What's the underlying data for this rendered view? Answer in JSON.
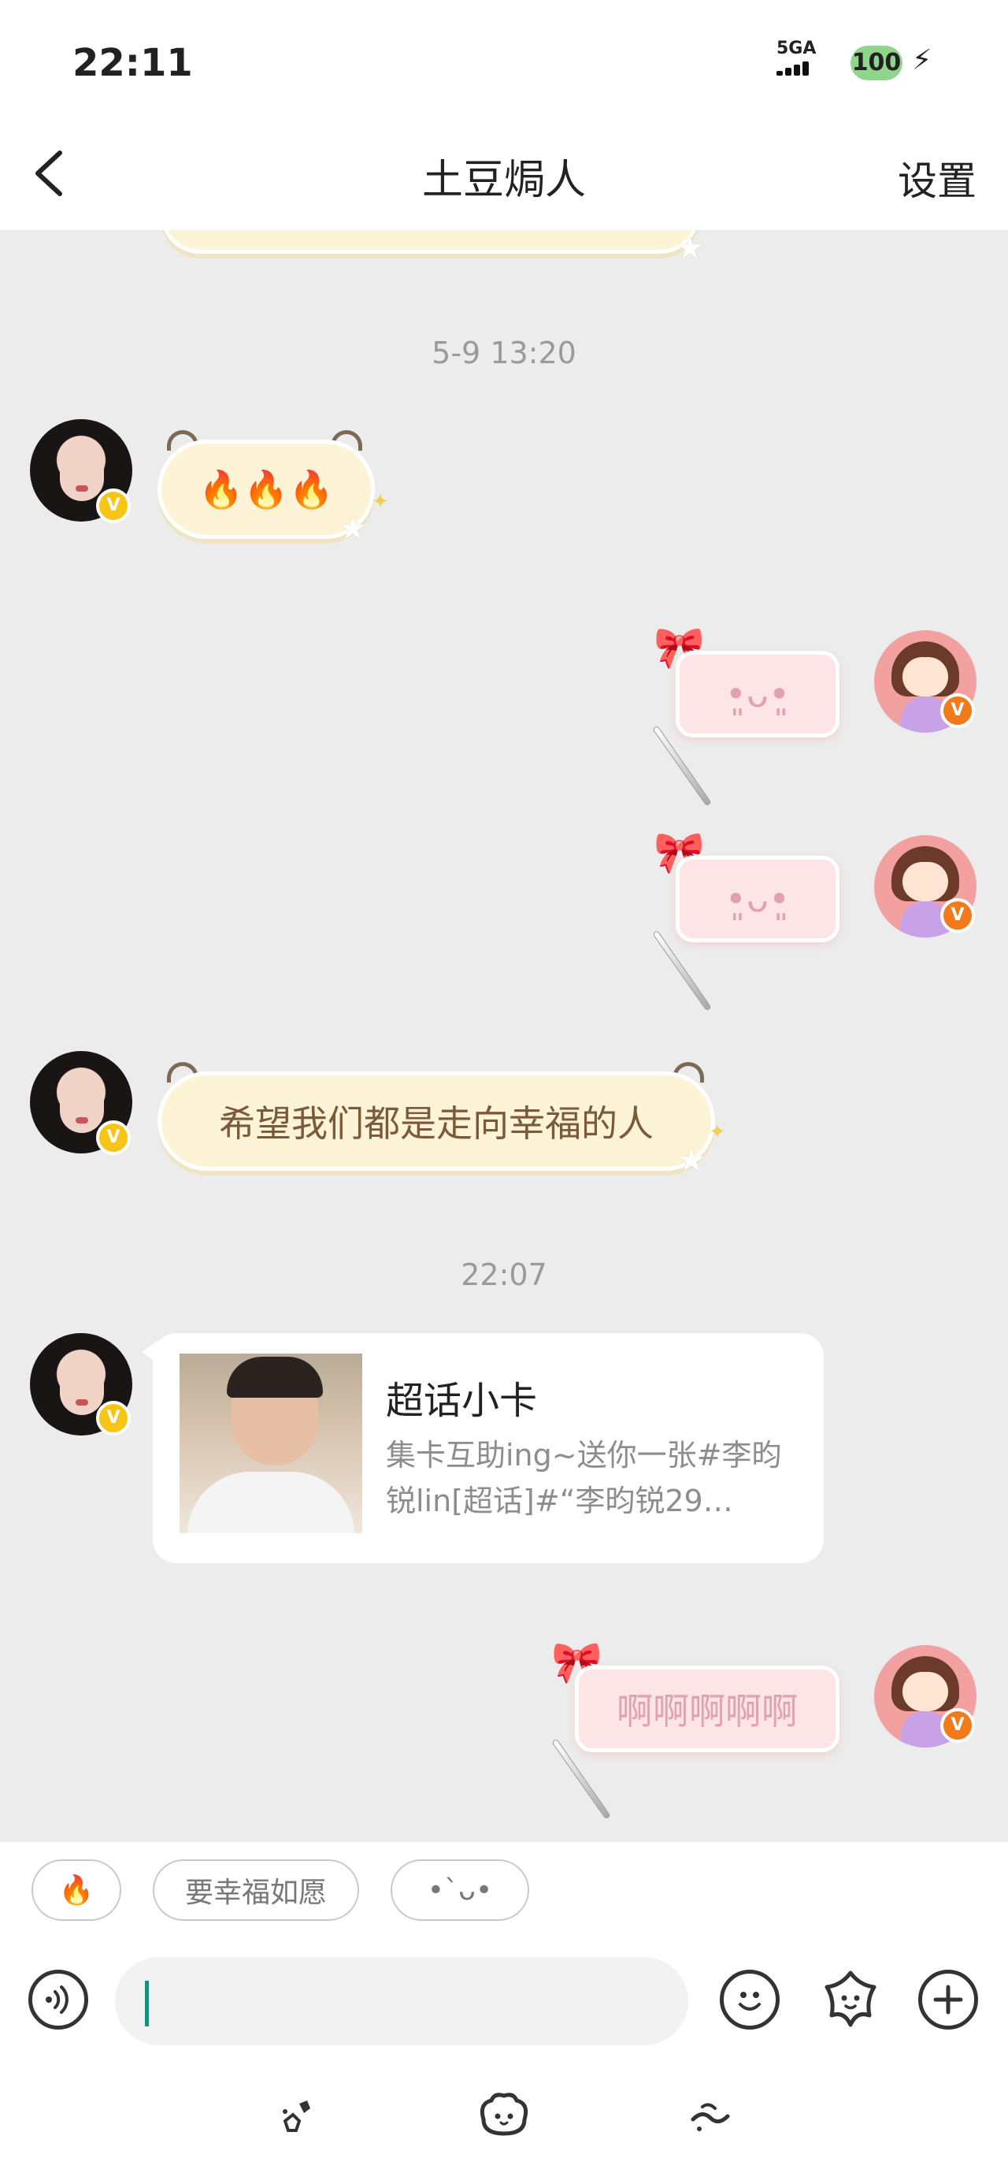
{
  "status_bar": {
    "time": "22:11",
    "network": "5GA",
    "battery": "100"
  },
  "header": {
    "title": "土豆焗人",
    "settings_label": "设置"
  },
  "chat": {
    "timestamps": [
      "5-9 13:20",
      "22:07"
    ],
    "messages": [
      {
        "from": "other",
        "type": "text",
        "text": "🔥🔥🔥"
      },
      {
        "from": "self",
        "type": "text",
        "text": "•͈ᴗ•͈"
      },
      {
        "from": "self",
        "type": "text",
        "text": "•͈ᴗ•͈"
      },
      {
        "from": "other",
        "type": "text",
        "text": "希望我们都是走向幸福的人"
      },
      {
        "from": "other",
        "type": "card",
        "title": "超话小卡",
        "description": "集卡互助ing~送你一张#李昀锐lin[超话]#“李昀锐29…"
      },
      {
        "from": "self",
        "type": "text",
        "text": "啊啊啊啊啊"
      }
    ],
    "badge_letter": "V"
  },
  "quick_replies": [
    "🔥",
    "要幸福如愿",
    "•`ᴗ•"
  ],
  "input": {
    "placeholder": ""
  },
  "colors": {
    "cream_bubble": "#fdf3d6",
    "pink_bubble": "#fde4e6",
    "caret": "#1b8f7e"
  },
  "icons": {
    "voice": "voice-icon",
    "emoji": "smiley-icon",
    "sticker": "flower-icon",
    "add": "plus-icon"
  }
}
